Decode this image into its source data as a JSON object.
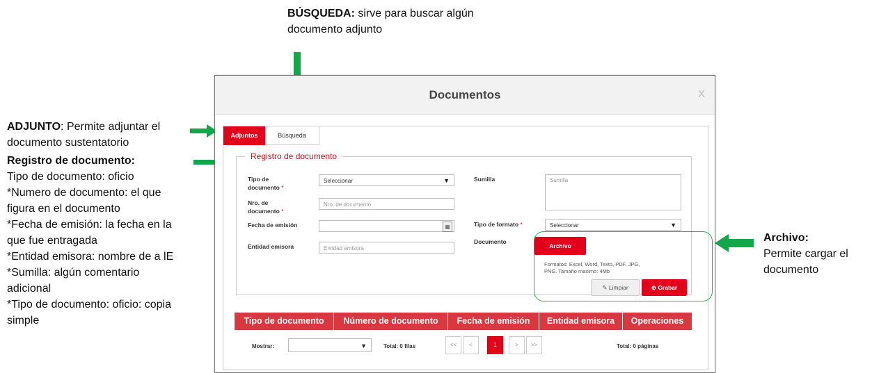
{
  "annotations": {
    "busqueda": {
      "title": "BÚSQUEDA:",
      "line1": " sirve para buscar algún",
      "line2": "documento adjunto"
    },
    "adjunto": {
      "title": "ADJUNTO",
      "line1": ": Permite adjuntar el",
      "line2": "documento sustentatorio"
    },
    "registro": {
      "title": "Registro de documento:",
      "lines": [
        "Tipo de documento: oficio",
        "*Numero de documento: el  que",
        "figura en el documento",
        "*Fecha de emisión: la fecha en la",
        "que fue entragada",
        "*Entidad emisora: nombre de a lE",
        "*Sumilla: algún comentario",
        "adicional",
        "*Tipo de documento: oficio: copia",
        "simple"
      ]
    },
    "archivo": {
      "title": "Archivo:",
      "line1": "Permite cargar el",
      "line2": "documento"
    }
  },
  "modal": {
    "title": "Documentos",
    "close": "X",
    "tabs": [
      "Adjuntos",
      "Búsqueda"
    ],
    "legend": "Registro de documento",
    "form": {
      "tipo_documento_label_1": "Tipo de",
      "tipo_documento_label_2": "documento",
      "tipo_documento_value": "Seleccionar",
      "nro_documento_label_1": "Nro. de",
      "nro_documento_label_2": "documento",
      "nro_documento_placeholder": "Nro. de documento",
      "fecha_emision_label": "Fecha de emisión",
      "entidad_emisora_label": "Entidad emisora",
      "entidad_emisora_placeholder": "Entidad emisora",
      "sumilla_label": "Sumilla",
      "sumilla_placeholder": "Sumilla",
      "tipo_formato_label": "Tipo de formato",
      "tipo_formato_value": "Seleccionar",
      "documento_label": "Documento",
      "required_mark": "*",
      "archivo_button": "Archivo",
      "formats_line1": "Formatos: Excel, Word, Texto, PDF, JPG,",
      "formats_line2": "PNG. Tamaño maximo: 4Mb",
      "limpiar_button": "Limpiar",
      "grabar_button": "Grabar"
    },
    "table": {
      "columns": [
        "Tipo de documento",
        "Número de documento",
        "Fecha de emisión",
        "Entidad emisora",
        "Operaciones"
      ]
    },
    "pager": {
      "mostrar_label": "Mostrar:",
      "total_filas": "Total: 0 filas",
      "buttons": [
        "<<",
        "<",
        "1",
        ">",
        ">>"
      ],
      "total_paginas": "Total: 0 páginas"
    }
  },
  "colors": {
    "accent_red": "#e3001b",
    "header_red": "#d9393e",
    "arrow_green": "#12a84a"
  }
}
